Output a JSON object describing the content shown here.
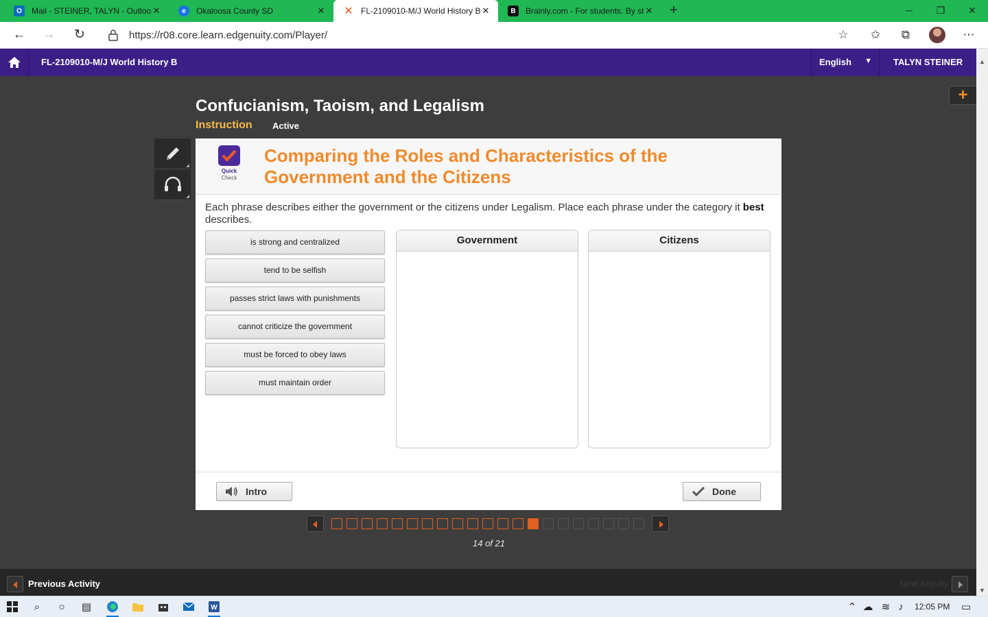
{
  "browser": {
    "tabs": [
      {
        "title": "Mail - STEINER, TALYN - Outlook",
        "icon": "outlook-icon",
        "color": "#0f6cbd"
      },
      {
        "title": "Okaloosa County SD",
        "icon": "globe-icon",
        "color": "#1a73e8"
      },
      {
        "title": "FL-2109010-M/J World History B",
        "icon": "edgenuity-icon",
        "color": "#e0601f"
      },
      {
        "title": "Brainly.com - For students. By students",
        "icon": "brainly-icon",
        "color": "#111111"
      }
    ],
    "active_tab": 2,
    "url": "https://r08.core.learn.edgenuity.com/Player/"
  },
  "header": {
    "course_title": "FL-2109010-M/J World History B",
    "language": "English",
    "user_name": "TALYN STEINER"
  },
  "lesson": {
    "title": "Confucianism, Taoism, and Legalism",
    "section": "Instruction",
    "status": "Active"
  },
  "activity": {
    "badge_line1": "Quick",
    "badge_line2": "Check",
    "title": "Comparing the Roles and Characteristics of the Government and the Citizens",
    "instruction_before": "Each phrase describes either the government or the citizens under Legalism. Place each phrase under the category it ",
    "instruction_bold": "best",
    "instruction_after": " describes.",
    "options": [
      "is strong and centralized",
      "tend to be selfish",
      "passes strict laws with punishments",
      "cannot criticize the government",
      "must be forced to obey laws",
      "must maintain order"
    ],
    "categories": [
      "Government",
      "Citizens"
    ],
    "intro_label": "Intro",
    "done_label": "Done"
  },
  "pager": {
    "total": 21,
    "current": 14,
    "label": "14 of 21"
  },
  "footer": {
    "previous_label": "Previous Activity",
    "next_label": "Next Activity"
  },
  "taskbar": {
    "time": "12:05 PM"
  },
  "colors": {
    "accent_orange": "#e0601f",
    "header_purple": "#3c1f86",
    "title_orange": "#f08a2c",
    "tab_green": "#1fb853"
  }
}
